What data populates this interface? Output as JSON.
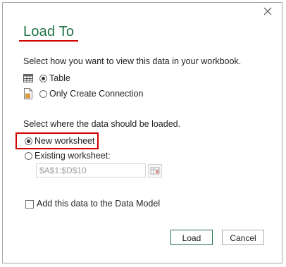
{
  "dialog": {
    "title": "Load To",
    "close_icon": "close-icon"
  },
  "view_section": {
    "prompt": "Select how you want to view this data in your workbook.",
    "options": [
      {
        "label": "Table",
        "icon": "table-icon",
        "selected": true
      },
      {
        "label": "Only Create Connection",
        "icon": "connection-icon",
        "selected": false
      }
    ]
  },
  "location_section": {
    "prompt": "Select where the data should be loaded.",
    "new_worksheet_label": "New worksheet",
    "new_worksheet_selected": true,
    "existing_worksheet_label": "Existing worksheet:",
    "existing_worksheet_selected": false,
    "range_value": "$A$1:$D$10"
  },
  "data_model": {
    "label": "Add this data to the Data Model",
    "checked": false
  },
  "buttons": {
    "load": "Load",
    "cancel": "Cancel"
  },
  "colors": {
    "accent": "#217346",
    "highlight": "#d10000"
  }
}
